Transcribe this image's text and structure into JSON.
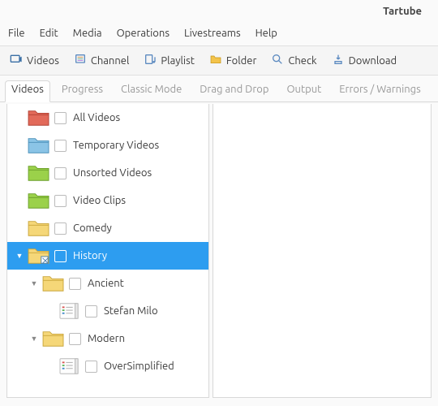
{
  "app": {
    "title": "Tartube"
  },
  "menubar": [
    "File",
    "Edit",
    "Media",
    "Operations",
    "Livestreams",
    "Help"
  ],
  "toolbar": [
    {
      "label": "Videos",
      "icon": "videos"
    },
    {
      "label": "Channel",
      "icon": "channel"
    },
    {
      "label": "Playlist",
      "icon": "playlist"
    },
    {
      "label": "Folder",
      "icon": "folder"
    },
    {
      "label": "Check",
      "icon": "check"
    },
    {
      "label": "Download",
      "icon": "download"
    }
  ],
  "tabs": [
    {
      "label": "Videos",
      "active": true
    },
    {
      "label": "Progress",
      "active": false
    },
    {
      "label": "Classic Mode",
      "active": false
    },
    {
      "label": "Drag and Drop",
      "active": false
    },
    {
      "label": "Output",
      "active": false
    },
    {
      "label": "Errors / Warnings",
      "active": false
    }
  ],
  "tree": [
    {
      "depth": 0,
      "icon": "folder-red",
      "expander": "",
      "label": "All Videos",
      "selected": false
    },
    {
      "depth": 0,
      "icon": "folder-blue",
      "expander": "",
      "label": "Temporary Videos",
      "selected": false
    },
    {
      "depth": 0,
      "icon": "folder-green",
      "expander": "",
      "label": "Unsorted Videos",
      "selected": false
    },
    {
      "depth": 0,
      "icon": "folder-green",
      "expander": "",
      "label": "Video Clips",
      "selected": false
    },
    {
      "depth": 0,
      "icon": "folder-yellow",
      "expander": "",
      "label": "Comedy",
      "selected": false
    },
    {
      "depth": 0,
      "icon": "folder-yellow-mark",
      "expander": "▼",
      "label": "History",
      "selected": true
    },
    {
      "depth": 1,
      "icon": "folder-yellow",
      "expander": "▼",
      "label": "Ancient",
      "selected": false
    },
    {
      "depth": 2,
      "icon": "channel-item",
      "expander": "",
      "label": "Stefan Milo",
      "selected": false
    },
    {
      "depth": 1,
      "icon": "folder-yellow",
      "expander": "▼",
      "label": "Modern",
      "selected": false
    },
    {
      "depth": 2,
      "icon": "channel-item",
      "expander": "",
      "label": "OverSimplified",
      "selected": false
    }
  ]
}
